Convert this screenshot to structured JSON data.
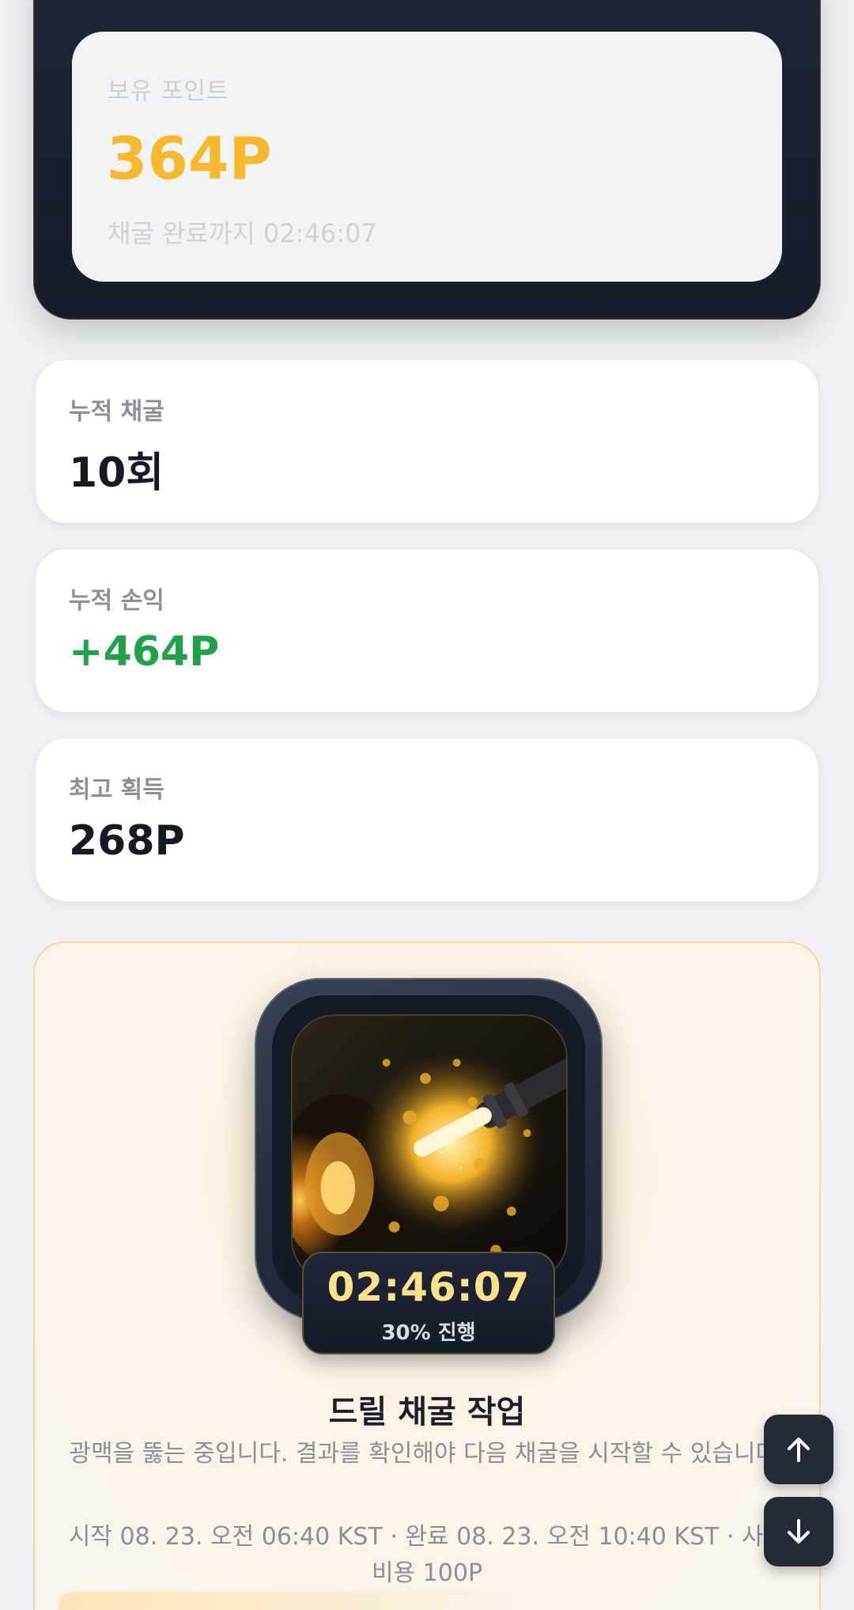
{
  "points": {
    "label": "보유 포인트",
    "value": "364P",
    "timer_text": "채굴 완료까지 02:46:07"
  },
  "stats": [
    {
      "label": "누적 채굴",
      "value": "10회"
    },
    {
      "label": "누적 손익",
      "value": "+464P"
    },
    {
      "label": "최고 획득",
      "value": "268P"
    }
  ],
  "mining": {
    "timer": "02:46:07",
    "progress_text": "30% 진행",
    "progress_fraction": 0.3,
    "title": "드릴 채굴 작업",
    "description": "광맥을 뚫는 중입니다. 결과를 확인해야 다음 채굴을 시작할 수 있습니다.",
    "meta": "시작 08. 23. 오전 06:40 KST · 완료 08. 23. 오전 10:40 KST · 사용 비용 100P",
    "image_icon": "gold-mine-drill-illustration"
  },
  "nav": {
    "up_icon": "arrow-up-icon",
    "down_icon": "arrow-down-icon"
  },
  "colors": {
    "gold": "#f5b82e",
    "profit_green": "#22a04a",
    "dark_navy": "#1e2536"
  }
}
